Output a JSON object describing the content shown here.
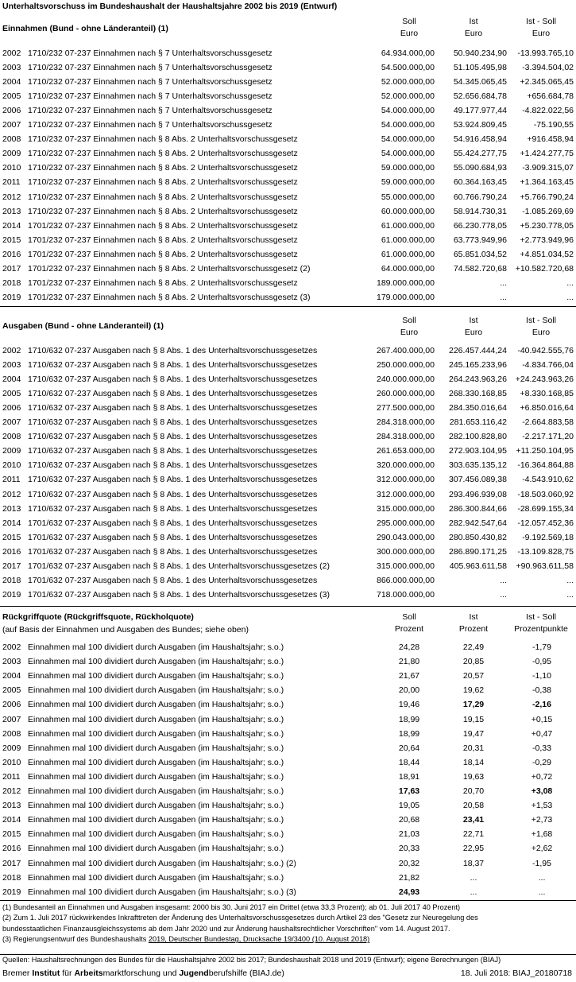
{
  "title": "Unterhaltsvorschuss im Bundeshaushalt der Haushaltsjahre 2002 bis 2019 (Entwurf)",
  "einnahmen": {
    "heading": "Einnahmen (Bund - ohne Länderanteil) (1)",
    "col_soll": [
      "Soll",
      "Euro"
    ],
    "col_ist": [
      "Ist",
      "Euro"
    ],
    "col_diff": [
      "Ist - Soll",
      "Euro"
    ],
    "rows": [
      {
        "year": "2002",
        "label": "1710/232 07-237 Einnahmen nach § 7 Unterhaltsvorschussgesetz",
        "soll": "64.934.000,00",
        "ist": "50.940.234,90",
        "diff": "-13.993.765,10"
      },
      {
        "year": "2003",
        "label": "1710/232 07-237 Einnahmen nach § 7 Unterhaltsvorschussgesetz",
        "soll": "54.500.000,00",
        "ist": "51.105.495,98",
        "diff": "-3.394.504,02"
      },
      {
        "year": "2004",
        "label": "1710/232 07-237 Einnahmen nach § 7 Unterhaltsvorschussgesetz",
        "soll": "52.000.000,00",
        "ist": "54.345.065,45",
        "diff": "+2.345.065,45"
      },
      {
        "year": "2005",
        "label": "1710/232 07-237 Einnahmen nach § 7 Unterhaltsvorschussgesetz",
        "soll": "52.000.000,00",
        "ist": "52.656.684,78",
        "diff": "+656.684,78"
      },
      {
        "year": "2006",
        "label": "1710/232 07-237 Einnahmen nach § 7 Unterhaltsvorschussgesetz",
        "soll": "54.000.000,00",
        "ist": "49.177.977,44",
        "diff": "-4.822.022,56"
      },
      {
        "year": "2007",
        "label": "1710/232 07-237 Einnahmen nach § 7 Unterhaltsvorschussgesetz",
        "soll": "54.000.000,00",
        "ist": "53.924.809,45",
        "diff": "-75.190,55"
      },
      {
        "year": "2008",
        "label": "1710/232 07-237 Einnahmen nach § 8 Abs. 2 Unterhaltsvorschussgesetz",
        "soll": "54.000.000,00",
        "ist": "54.916.458,94",
        "diff": "+916.458,94"
      },
      {
        "year": "2009",
        "label": "1710/232 07-237 Einnahmen nach § 8 Abs. 2 Unterhaltsvorschussgesetz",
        "soll": "54.000.000,00",
        "ist": "55.424.277,75",
        "diff": "+1.424.277,75"
      },
      {
        "year": "2010",
        "label": "1710/232 07-237 Einnahmen nach § 8 Abs. 2 Unterhaltsvorschussgesetz",
        "soll": "59.000.000,00",
        "ist": "55.090.684,93",
        "diff": "-3.909.315,07"
      },
      {
        "year": "2011",
        "label": "1710/232 07-237 Einnahmen nach § 8 Abs. 2 Unterhaltsvorschussgesetz",
        "soll": "59.000.000,00",
        "ist": "60.364.163,45",
        "diff": "+1.364.163,45"
      },
      {
        "year": "2012",
        "label": "1710/232 07-237 Einnahmen nach § 8 Abs. 2 Unterhaltsvorschussgesetz",
        "soll": "55.000.000,00",
        "ist": "60.766.790,24",
        "diff": "+5.766.790,24"
      },
      {
        "year": "2013",
        "label": "1710/232 07-237 Einnahmen nach § 8 Abs. 2 Unterhaltsvorschussgesetz",
        "soll": "60.000.000,00",
        "ist": "58.914.730,31",
        "diff": "-1.085.269,69"
      },
      {
        "year": "2014",
        "label": "1701/232 07-237 Einnahmen nach § 8 Abs. 2 Unterhaltsvorschussgesetz",
        "soll": "61.000.000,00",
        "ist": "66.230.778,05",
        "diff": "+5.230.778,05"
      },
      {
        "year": "2015",
        "label": "1701/232 07-237 Einnahmen nach § 8 Abs. 2 Unterhaltsvorschussgesetz",
        "soll": "61.000.000,00",
        "ist": "63.773.949,96",
        "diff": "+2.773.949,96"
      },
      {
        "year": "2016",
        "label": "1701/232 07-237 Einnahmen nach § 8 Abs. 2 Unterhaltsvorschussgesetz",
        "soll": "61.000.000,00",
        "ist": "65.851.034,52",
        "diff": "+4.851.034,52"
      },
      {
        "year": "2017",
        "label": "1701/232 07-237 Einnahmen nach § 8 Abs. 2 Unterhaltsvorschussgesetz (2)",
        "soll": "64.000.000,00",
        "ist": "74.582.720,68",
        "diff": "+10.582.720,68"
      },
      {
        "year": "2018",
        "label": "1701/232 07-237 Einnahmen nach § 8 Abs. 2 Unterhaltsvorschussgesetz",
        "soll": "189.000.000,00",
        "ist": "...",
        "diff": "..."
      },
      {
        "year": "2019",
        "label": "1701/232 07-237 Einnahmen nach § 8 Abs. 2 Unterhaltsvorschussgesetz (3)",
        "soll": "179.000.000,00",
        "ist": "...",
        "diff": "..."
      }
    ]
  },
  "ausgaben": {
    "heading": "Ausgaben (Bund - ohne Länderanteil) (1)",
    "col_soll": [
      "Soll",
      "Euro"
    ],
    "col_ist": [
      "Ist",
      "Euro"
    ],
    "col_diff": [
      "Ist - Soll",
      "Euro"
    ],
    "rows": [
      {
        "year": "2002",
        "label": "1710/632 07-237 Ausgaben nach § 8 Abs. 1 des Unterhaltsvorschussgesetzes",
        "soll": "267.400.000,00",
        "ist": "226.457.444,24",
        "diff": "-40.942.555,76"
      },
      {
        "year": "2003",
        "label": "1710/632 07-237 Ausgaben nach § 8 Abs. 1 des Unterhaltsvorschussgesetzes",
        "soll": "250.000.000,00",
        "ist": "245.165.233,96",
        "diff": "-4.834.766,04"
      },
      {
        "year": "2004",
        "label": "1710/632 07-237 Ausgaben nach § 8 Abs. 1 des Unterhaltsvorschussgesetzes",
        "soll": "240.000.000,00",
        "ist": "264.243.963,26",
        "diff": "+24.243.963,26"
      },
      {
        "year": "2005",
        "label": "1710/632 07-237 Ausgaben nach § 8 Abs. 1 des Unterhaltsvorschussgesetzes",
        "soll": "260.000.000,00",
        "ist": "268.330.168,85",
        "diff": "+8.330.168,85"
      },
      {
        "year": "2006",
        "label": "1710/632 07-237 Ausgaben nach § 8 Abs. 1 des Unterhaltsvorschussgesetzes",
        "soll": "277.500.000,00",
        "ist": "284.350.016,64",
        "diff": "+6.850.016,64"
      },
      {
        "year": "2007",
        "label": "1710/632 07-237 Ausgaben nach § 8 Abs. 1 des Unterhaltsvorschussgesetzes",
        "soll": "284.318.000,00",
        "ist": "281.653.116,42",
        "diff": "-2.664.883,58"
      },
      {
        "year": "2008",
        "label": "1710/632 07-237 Ausgaben nach § 8 Abs. 1 des Unterhaltsvorschussgesetzes",
        "soll": "284.318.000,00",
        "ist": "282.100.828,80",
        "diff": "-2.217.171,20"
      },
      {
        "year": "2009",
        "label": "1710/632 07-237 Ausgaben nach § 8 Abs. 1 des Unterhaltsvorschussgesetzes",
        "soll": "261.653.000,00",
        "ist": "272.903.104,95",
        "diff": "+11.250.104,95"
      },
      {
        "year": "2010",
        "label": "1710/632 07-237 Ausgaben nach § 8 Abs. 1 des Unterhaltsvorschussgesetzes",
        "soll": "320.000.000,00",
        "ist": "303.635.135,12",
        "diff": "-16.364.864,88"
      },
      {
        "year": "2011",
        "label": "1710/632 07-237 Ausgaben nach § 8 Abs. 1 des Unterhaltsvorschussgesetzes",
        "soll": "312.000.000,00",
        "ist": "307.456.089,38",
        "diff": "-4.543.910,62"
      },
      {
        "year": "2012",
        "label": "1710/632 07-237 Ausgaben nach § 8 Abs. 1 des Unterhaltsvorschussgesetzes",
        "soll": "312.000.000,00",
        "ist": "293.496.939,08",
        "diff": "-18.503.060,92"
      },
      {
        "year": "2013",
        "label": "1710/632 07-237 Ausgaben nach § 8 Abs. 1 des Unterhaltsvorschussgesetzes",
        "soll": "315.000.000,00",
        "ist": "286.300.844,66",
        "diff": "-28.699.155,34"
      },
      {
        "year": "2014",
        "label": "1701/632 07-237 Ausgaben nach § 8 Abs. 1 des Unterhaltsvorschussgesetzes",
        "soll": "295.000.000,00",
        "ist": "282.942.547,64",
        "diff": "-12.057.452,36"
      },
      {
        "year": "2015",
        "label": "1701/632 07-237 Ausgaben nach § 8 Abs. 1 des Unterhaltsvorschussgesetzes",
        "soll": "290.043.000,00",
        "ist": "280.850.430,82",
        "diff": "-9.192.569,18"
      },
      {
        "year": "2016",
        "label": "1701/632 07-237 Ausgaben nach § 8 Abs. 1 des Unterhaltsvorschussgesetzes",
        "soll": "300.000.000,00",
        "ist": "286.890.171,25",
        "diff": "-13.109.828,75"
      },
      {
        "year": "2017",
        "label": "1701/632 07-237 Ausgaben nach § 8 Abs. 1 des Unterhaltsvorschussgesetzes (2)",
        "soll": "315.000.000,00",
        "ist": "405.963.611,58",
        "diff": "+90.963.611,58"
      },
      {
        "year": "2018",
        "label": "1701/632 07-237 Ausgaben nach § 8 Abs. 1 des Unterhaltsvorschussgesetzes",
        "soll": "866.000.000,00",
        "ist": "...",
        "diff": "..."
      },
      {
        "year": "2019",
        "label": "1701/632 07-237 Ausgaben nach § 8 Abs. 1 des Unterhaltsvorschussgesetzes (3)",
        "soll": "718.000.000,00",
        "ist": "...",
        "diff": "..."
      }
    ]
  },
  "quote": {
    "heading": "Rückgriffquote (Rückgriffsquote, Rückholquote)",
    "subheading": "(auf Basis der Einnahmen und Ausgaben des Bundes; siehe oben)",
    "col_soll": [
      "Soll",
      "Prozent"
    ],
    "col_ist": [
      "Ist",
      "Prozent"
    ],
    "col_diff": [
      "Ist - Soll",
      "Prozentpunkte"
    ],
    "rows": [
      {
        "year": "2002",
        "label": "Einnahmen mal 100 dividiert durch Ausgaben (im Haushaltsjahr; s.o.)",
        "soll": "24,28",
        "ist": "22,49",
        "diff": "-1,79"
      },
      {
        "year": "2003",
        "label": "Einnahmen mal 100 dividiert durch Ausgaben (im Haushaltsjahr; s.o.)",
        "soll": "21,80",
        "ist": "20,85",
        "diff": "-0,95"
      },
      {
        "year": "2004",
        "label": "Einnahmen mal 100 dividiert durch Ausgaben (im Haushaltsjahr; s.o.)",
        "soll": "21,67",
        "ist": "20,57",
        "diff": "-1,10"
      },
      {
        "year": "2005",
        "label": "Einnahmen mal 100 dividiert durch Ausgaben (im Haushaltsjahr; s.o.)",
        "soll": "20,00",
        "ist": "19,62",
        "diff": "-0,38"
      },
      {
        "year": "2006",
        "label": "Einnahmen mal 100 dividiert durch Ausgaben (im Haushaltsjahr; s.o.)",
        "soll": "19,46",
        "ist": "17,29",
        "diff": "-2,16",
        "bold_ist": true,
        "bold_diff": true
      },
      {
        "year": "2007",
        "label": "Einnahmen mal 100 dividiert durch Ausgaben (im Haushaltsjahr; s.o.)",
        "soll": "18,99",
        "ist": "19,15",
        "diff": "+0,15"
      },
      {
        "year": "2008",
        "label": "Einnahmen mal 100 dividiert durch Ausgaben (im Haushaltsjahr; s.o.)",
        "soll": "18,99",
        "ist": "19,47",
        "diff": "+0,47"
      },
      {
        "year": "2009",
        "label": "Einnahmen mal 100 dividiert durch Ausgaben (im Haushaltsjahr; s.o.)",
        "soll": "20,64",
        "ist": "20,31",
        "diff": "-0,33"
      },
      {
        "year": "2010",
        "label": "Einnahmen mal 100 dividiert durch Ausgaben (im Haushaltsjahr; s.o.)",
        "soll": "18,44",
        "ist": "18,14",
        "diff": "-0,29"
      },
      {
        "year": "2011",
        "label": "Einnahmen mal 100 dividiert durch Ausgaben (im Haushaltsjahr; s.o.)",
        "soll": "18,91",
        "ist": "19,63",
        "diff": "+0,72"
      },
      {
        "year": "2012",
        "label": "Einnahmen mal 100 dividiert durch Ausgaben (im Haushaltsjahr; s.o.)",
        "soll": "17,63",
        "ist": "20,70",
        "diff": "+3,08",
        "bold_soll": true,
        "bold_diff": true
      },
      {
        "year": "2013",
        "label": "Einnahmen mal 100 dividiert durch Ausgaben (im Haushaltsjahr; s.o.)",
        "soll": "19,05",
        "ist": "20,58",
        "diff": "+1,53"
      },
      {
        "year": "2014",
        "label": "Einnahmen mal 100 dividiert durch Ausgaben (im Haushaltsjahr; s.o.)",
        "soll": "20,68",
        "ist": "23,41",
        "diff": "+2,73",
        "bold_ist": true
      },
      {
        "year": "2015",
        "label": "Einnahmen mal 100 dividiert durch Ausgaben (im Haushaltsjahr; s.o.)",
        "soll": "21,03",
        "ist": "22,71",
        "diff": "+1,68"
      },
      {
        "year": "2016",
        "label": "Einnahmen mal 100 dividiert durch Ausgaben (im Haushaltsjahr; s.o.)",
        "soll": "20,33",
        "ist": "22,95",
        "diff": "+2,62"
      },
      {
        "year": "2017",
        "label": "Einnahmen mal 100 dividiert durch Ausgaben (im Haushaltsjahr; s.o.) (2)",
        "soll": "20,32",
        "ist": "18,37",
        "diff": "-1,95"
      },
      {
        "year": "2018",
        "label": "Einnahmen mal 100 dividiert durch Ausgaben (im Haushaltsjahr; s.o.)",
        "soll": "21,82",
        "ist": "...",
        "diff": "..."
      },
      {
        "year": "2019",
        "label": "Einnahmen mal 100 dividiert durch Ausgaben (im Haushaltsjahr; s.o.) (3)",
        "soll": "24,93",
        "ist": "...",
        "diff": "...",
        "bold_soll": true
      }
    ]
  },
  "notes": {
    "n1": "(1) Bundesanteil an Einnahmen und Ausgaben insgesamt: 2000 bis 30. Juni 2017 ein Drittel (etwa 33,3 Prozent); ab 01. Juli 2017 40 Prozent)",
    "n2a": "(2) Zum 1. Juli 2017 rückwirkendes Inkrafttreten der Änderung des Unterhaltsvorschussgesetzes durch Artikel 23 des \"Gesetz zur Neuregelung des",
    "n2b": "bundesstaatlichen Finanzausgleichssystems ab dem Jahr 2020 und zur Änderung haushaltsrechtlicher Vorschriften\" vom 14. August 2017.",
    "n3_prefix": "(3) Regierungsentwurf des Bundeshaushalts ",
    "n3_link": "2019, Deutscher Bundestag, Drucksache 19/3400 (10. August 2018)",
    "sources": "Quellen: Haushaltsrechnungen des Bundes für die Haushaltsjahre 2002 bis 2017; Bundeshaushalt 2018 und 2019 (Entwurf); eigene Berechnungen (BIAJ)"
  },
  "footer": {
    "org_parts": [
      {
        "t": "Bremer ",
        "b": false
      },
      {
        "t": "Institut",
        "b": true
      },
      {
        "t": " für ",
        "b": false
      },
      {
        "t": "Arbeits",
        "b": true
      },
      {
        "t": "marktforschung und ",
        "b": false
      },
      {
        "t": "Jugend",
        "b": true
      },
      {
        "t": "berufshilfe (BIAJ.de)",
        "b": false
      }
    ],
    "right": "18. Juli 2018: BIAJ_20180718"
  }
}
